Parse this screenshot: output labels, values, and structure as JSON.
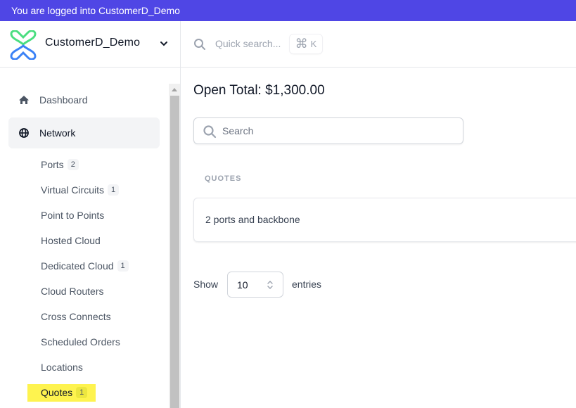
{
  "banner": {
    "text": "You are logged into CustomerD_Demo",
    "color": "#4f46e5"
  },
  "org": {
    "name": "CustomerD_Demo",
    "logo_colors": {
      "top": "#4ade80",
      "bottom": "#3b82f6"
    }
  },
  "topbar": {
    "quick_search_placeholder": "Quick search...",
    "shortcut_symbol": "⌘",
    "shortcut_key": "K"
  },
  "sidebar": {
    "items": [
      {
        "label": "Dashboard",
        "icon": "home-icon",
        "active": false
      },
      {
        "label": "Network",
        "icon": "globe-icon",
        "active": true
      }
    ],
    "sub_items": [
      {
        "label": "Ports",
        "badge": "2"
      },
      {
        "label": "Virtual Circuits",
        "badge": "1"
      },
      {
        "label": "Point to Points",
        "badge": null
      },
      {
        "label": "Hosted Cloud",
        "badge": null
      },
      {
        "label": "Dedicated Cloud",
        "badge": "1"
      },
      {
        "label": "Cloud Routers",
        "badge": null
      },
      {
        "label": "Cross Connects",
        "badge": null
      },
      {
        "label": "Scheduled Orders",
        "badge": null
      },
      {
        "label": "Locations",
        "badge": null
      },
      {
        "label": "Quotes",
        "badge": "1",
        "highlighted": true
      }
    ],
    "highlight_color": "#fef34f"
  },
  "main": {
    "open_total": "Open Total: $1,300.00",
    "search_placeholder": "Search",
    "section_label": "QUOTES",
    "quotes": [
      {
        "name": "2 ports and backbone"
      }
    ],
    "pagination": {
      "show_label": "Show",
      "entries_value": "10",
      "entries_label": "entries"
    }
  }
}
